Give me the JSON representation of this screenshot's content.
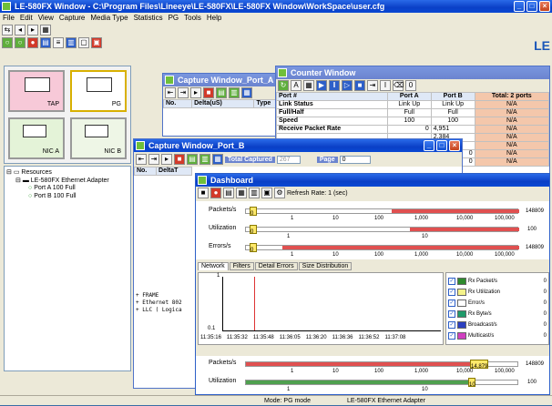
{
  "main_window": {
    "title": "LE-580FX Window - C:\\Program Files\\Lineeye\\LE-580FX\\LE-580FX Window\\WorkSpace\\user.cfg",
    "menu": [
      "File",
      "Edit",
      "View",
      "Capture",
      "Media Type",
      "Statistics",
      "PG",
      "Tools",
      "Help"
    ],
    "logo": "LE",
    "status_mode": "Mode: PG mode",
    "status_adapter": "LE-580FX Ethernet Adapter"
  },
  "mode_tiles": [
    {
      "label": "TAP"
    },
    {
      "label": "PG"
    },
    {
      "label": "NIC A"
    },
    {
      "label": "NIC B"
    }
  ],
  "resources_tree": {
    "root": "Resources",
    "adapter": "LE-580FX Ethernet Adapter",
    "ports": [
      "Port A 100 Full",
      "Port B 100 Full"
    ]
  },
  "capture_a": {
    "title": "Capture Window_Port_A",
    "columns": [
      "No.",
      "Delta(uS)",
      "Type",
      "L"
    ]
  },
  "capture_b": {
    "title": "Capture Window_Port_B",
    "total_captured_label": "Total Captured",
    "total_captured_value": "267",
    "page_label": "Page",
    "page_value": "0",
    "columns": [
      "No.",
      "DeltaT"
    ],
    "tree_lines": [
      "+ FRAME",
      "+ Ethernet 802",
      "+ LLC ( Logica"
    ]
  },
  "counter": {
    "title": "Counter Window",
    "columns": [
      "Port #",
      "Port A",
      "Port B",
      "Total: 2 ports"
    ],
    "rows": [
      {
        "name": "Link Status",
        "a": "Link Up",
        "b": "Link Up",
        "t": "N/A"
      },
      {
        "name": "Full/Half",
        "a": "Full",
        "b": "Full",
        "t": "N/A"
      },
      {
        "name": "Speed",
        "a": "100",
        "b": "100",
        "t": "N/A"
      },
      {
        "name": "Receive Packet Rate",
        "a": "0",
        "b": "4,951",
        "t": "N/A"
      },
      {
        "name": "",
        "a": "",
        "b": "2,384",
        "t": "N/A"
      },
      {
        "name": "",
        "a": "",
        "b": "10.00",
        "t": "N/A"
      },
      {
        "name": "",
        "a": "",
        "b": "0",
        "t": "N/A"
      },
      {
        "name": "",
        "a": "",
        "b": "0",
        "t": "N/A"
      }
    ]
  },
  "dashboard": {
    "title": "Dashboard",
    "refresh": "Refresh Rate: 1 (sec)",
    "gauges": [
      {
        "label": "Packets/s",
        "knob": "0",
        "ticks": [
          "1",
          "10",
          "100",
          "1,000",
          "10,000",
          "100,000"
        ],
        "max": "148809"
      },
      {
        "label": "Utilization",
        "knob": "0",
        "ticks": [
          "1",
          "10"
        ],
        "max": "100"
      },
      {
        "label": "Errors/s",
        "knob": "0",
        "ticks": [
          "1",
          "10",
          "100",
          "1,000",
          "10,000",
          "100,000"
        ],
        "max": "148809"
      }
    ],
    "tabs": [
      "Network",
      "Filters",
      "Detail Errors",
      "Size Distribution"
    ],
    "chart_y_top": "1",
    "chart_y_bottom": "0.1",
    "chart_x_labels": [
      "11:35:16",
      "11:35:32",
      "11:35:48",
      "11:36:05",
      "11:36:20",
      "11:36:36",
      "11:36:52",
      "11:37:08"
    ],
    "legend": [
      {
        "name": "Rx Packet/s",
        "color": "#2e8b2e",
        "value": "0"
      },
      {
        "name": "Rx Utilization",
        "color": "#f4f28a",
        "value": "0"
      },
      {
        "name": "Error/s",
        "color": "#ffffff",
        "value": "0"
      },
      {
        "name": "Rx Byte/s",
        "color": "#1f9a6a",
        "value": "0"
      },
      {
        "name": "Broadcast/s",
        "color": "#2b3fbf",
        "value": "0"
      },
      {
        "name": "Multicast/s",
        "color": "#d040c0",
        "value": "0"
      }
    ],
    "bottom_gauges": [
      {
        "label": "Packets/s",
        "knob": "14,879",
        "ticks": [
          "1",
          "10",
          "100",
          "1,000",
          "10,000",
          "100,000"
        ],
        "max": "148809"
      },
      {
        "label": "Utilization",
        "knob": "10",
        "ticks": [
          "1",
          "10"
        ],
        "max": "100"
      }
    ]
  }
}
